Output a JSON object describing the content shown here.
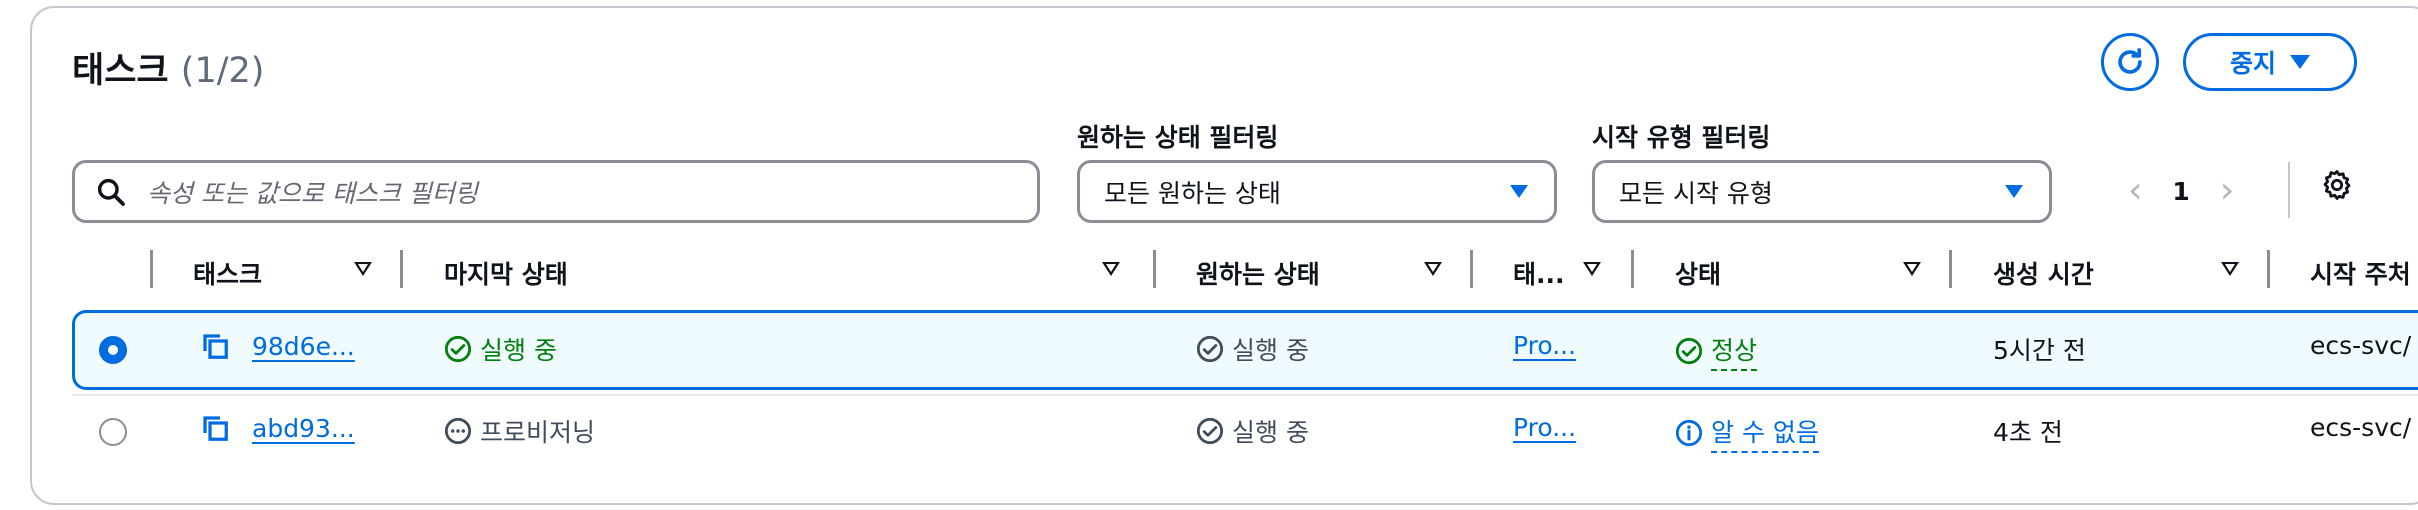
{
  "header": {
    "title": "태스크",
    "count": "(1/2)",
    "stop_label": "중지"
  },
  "filters": {
    "search_placeholder": "속성 또는 값으로 태스크 필터링",
    "desired_status_label": "원하는 상태 필터링",
    "desired_status_value": "모든 원하는 상태",
    "launch_type_label": "시작 유형 필터링",
    "launch_type_value": "모든 시작 유형"
  },
  "pagination": {
    "current_page": "1"
  },
  "columns": [
    "태스크",
    "마지막 상태",
    "원하는 상태",
    "태...",
    "상태",
    "생성 시간",
    "시작 주체"
  ],
  "columns_display_last": "시작 주처",
  "rows": [
    {
      "selected": true,
      "task": "98d6e...",
      "last_status": "실행 중",
      "desired_status": "실행 중",
      "task_def": "Pro...",
      "health": "정상",
      "created": "5시간 전",
      "started_by": "ecs-svc/"
    },
    {
      "selected": false,
      "task": "abd93...",
      "last_status": "프로비저닝",
      "desired_status": "실행 중",
      "task_def": "Pro...",
      "health": "알 수 없음",
      "created": "4초 전",
      "started_by": "ecs-svc/"
    }
  ],
  "colors": {
    "accent": "#006ce0",
    "success": "#037f0c",
    "border": "#8c8c94"
  }
}
